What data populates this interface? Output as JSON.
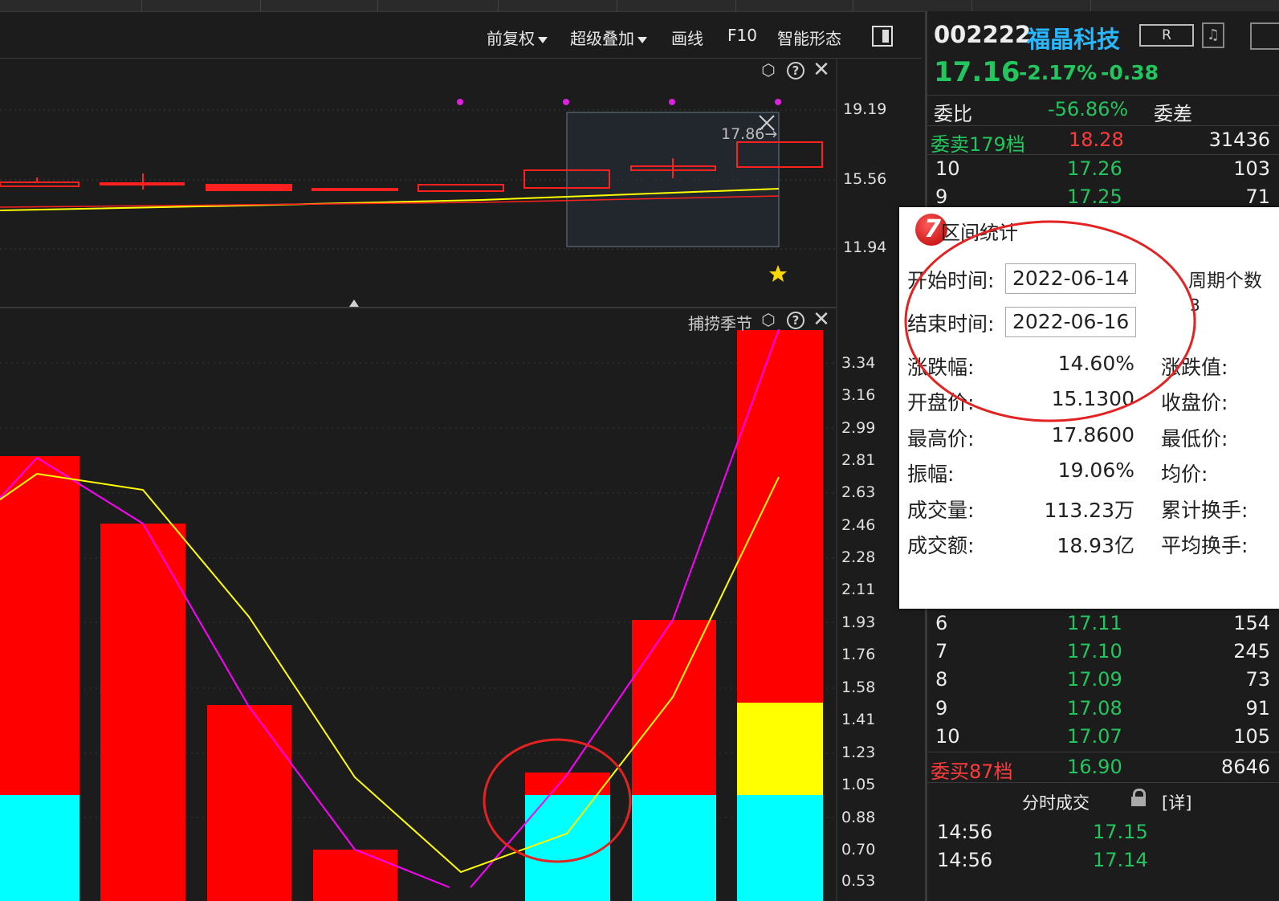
{
  "toolbar": {
    "items": [
      {
        "label": "前复权",
        "has_caret": true
      },
      {
        "label": "超级叠加",
        "has_caret": true
      },
      {
        "label": "画线",
        "has_caret": false
      },
      {
        "label": "F10",
        "has_caret": false
      },
      {
        "label": "智能形态",
        "has_caret": false
      }
    ],
    "panel_toggle_icon": "panel-toggle-icon"
  },
  "kline": {
    "price_labels": [
      "19.19",
      "15.56",
      "11.94"
    ],
    "marker_price": "17.86",
    "controls": [
      "settings-icon",
      "help-icon",
      "close-icon"
    ],
    "selected_period_highlight": true
  },
  "indicator": {
    "name": "捕捞季节",
    "y_labels": [
      "3.34",
      "3.16",
      "2.99",
      "2.81",
      "2.63",
      "2.46",
      "2.28",
      "2.11",
      "1.93",
      "1.76",
      "1.58",
      "1.41",
      "1.23",
      "1.05",
      "0.88",
      "0.70",
      "0.53"
    ],
    "colors": {
      "bar": "#ff0000",
      "base": "#00ffff",
      "yellow_block": "#ffff00",
      "line1": "#ff00ff",
      "line2": "#ffff00"
    }
  },
  "stock": {
    "code": "002222",
    "name": "福晶科技",
    "price": "17.16",
    "change_pct": "-2.17%",
    "change": "-0.38",
    "badge": "R",
    "wei_bi_label": "委比",
    "wei_bi_value": "-56.86%",
    "wei_cha_label": "委差"
  },
  "order_book": {
    "sell_header": {
      "label": "委卖179档",
      "price": "18.28",
      "volume": "31436"
    },
    "sell_rows": [
      {
        "level": "10",
        "price": "17.26",
        "volume": "103"
      },
      {
        "level": "9",
        "price": "17.25",
        "volume": "71"
      }
    ],
    "buy_rows": [
      {
        "level": "6",
        "price": "17.11",
        "volume": "154"
      },
      {
        "level": "7",
        "price": "17.10",
        "volume": "245"
      },
      {
        "level": "8",
        "price": "17.09",
        "volume": "73"
      },
      {
        "level": "9",
        "price": "17.08",
        "volume": "91"
      },
      {
        "level": "10",
        "price": "17.07",
        "volume": "105"
      }
    ],
    "buy_header": {
      "label": "委买87档",
      "price": "16.90",
      "volume": "8646"
    }
  },
  "ticks": {
    "title": "分时成交",
    "detail": "[详]",
    "rows": [
      {
        "time": "14:56",
        "price": "17.15"
      },
      {
        "time": "14:56",
        "price": "17.14"
      }
    ]
  },
  "popup": {
    "title": "区间统计",
    "start_label": "开始时间:",
    "start_value": "2022-06-14",
    "end_label": "结束时间:",
    "end_value": "2022-06-16",
    "period_label": "周期个数",
    "period_value": "3",
    "stats_left": [
      {
        "label": "涨跌幅:",
        "value": "14.60%"
      },
      {
        "label": "开盘价:",
        "value": "15.1300"
      },
      {
        "label": "最高价:",
        "value": "17.8600"
      },
      {
        "label": "振幅:",
        "value": "19.06%"
      },
      {
        "label": "成交量:",
        "value": "113.23万"
      },
      {
        "label": "成交额:",
        "value": "18.93亿"
      }
    ],
    "stats_right": [
      "涨跌值:",
      "收盘价:",
      "最低价:",
      "均价:",
      "累计换手:",
      "平均换手:"
    ]
  }
}
